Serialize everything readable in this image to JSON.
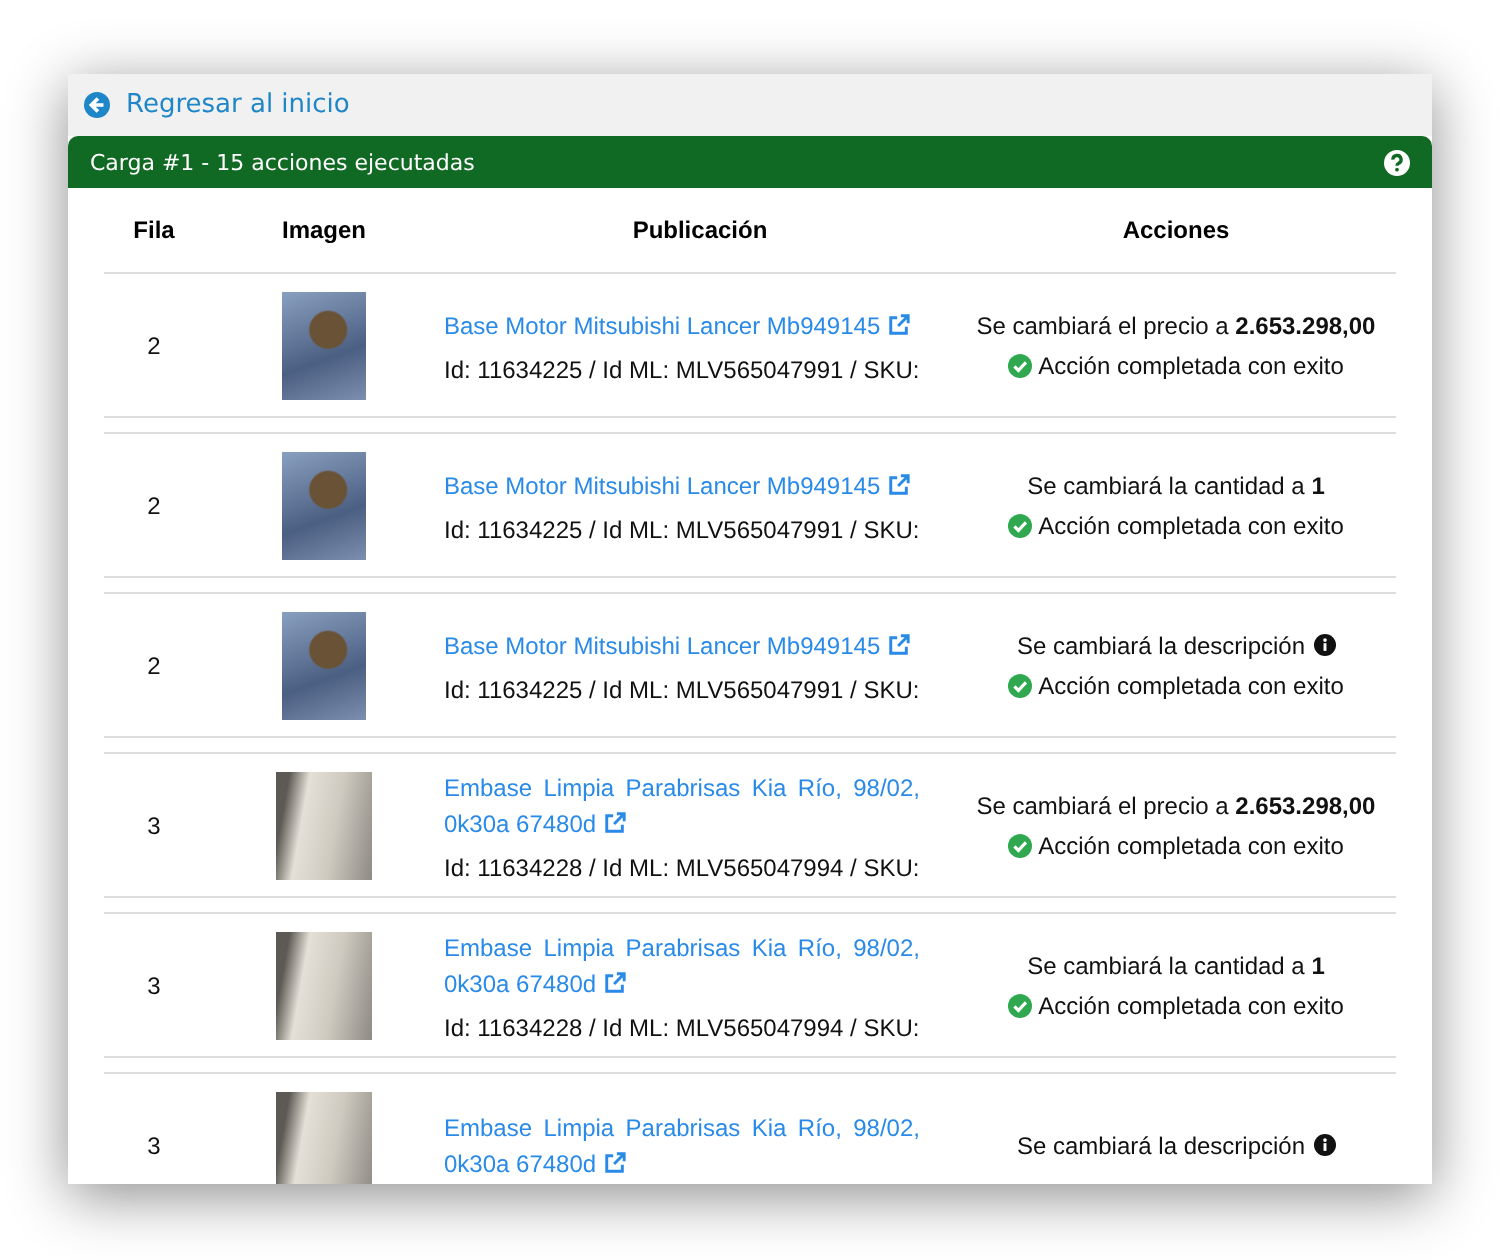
{
  "back_link": {
    "label": "Regresar al inicio"
  },
  "panel": {
    "title": "Carga #1 - 15 acciones ejecutadas"
  },
  "table": {
    "columns": [
      "Fila",
      "Imagen",
      "Publicación",
      "Acciones"
    ],
    "rows": [
      {
        "fila": "2",
        "title": "Base Motor Mitsubishi Lancer Mb949145",
        "meta": "Id: 11634225 / Id ML: MLV565047991 / SKU:",
        "action": {
          "kind": "price",
          "text": "Se cambiará el precio a **2.653.298,00**"
        },
        "status": {
          "success": true,
          "text": "Acción completada con exito"
        }
      },
      {
        "fila": "2",
        "title": "Base Motor Mitsubishi Lancer Mb949145",
        "meta": "Id: 11634225 / Id ML: MLV565047991 / SKU:",
        "action": {
          "kind": "quantity",
          "text": "Se cambiará la cantidad a **1**"
        },
        "status": {
          "success": true,
          "text": "Acción completada con exito"
        }
      },
      {
        "fila": "2",
        "title": "Base Motor Mitsubishi Lancer Mb949145",
        "meta": "Id: 11634225 / Id ML: MLV565047991 / SKU:",
        "action": {
          "kind": "description",
          "text": "Se cambiará la descripción"
        },
        "status": {
          "success": true,
          "text": "Acción completada con exito"
        }
      },
      {
        "fila": "3",
        "title": "Embase Limpia Parabrisas Kia Río, 98/02, 0k30a 67480d",
        "meta": "Id: 11634228 / Id ML: MLV565047994 / SKU:",
        "action": {
          "kind": "price",
          "text": "Se cambiará el precio a **2.653.298,00**"
        },
        "status": {
          "success": true,
          "text": "Acción completada con exito"
        }
      },
      {
        "fila": "3",
        "title": "Embase Limpia Parabrisas Kia Río, 98/02, 0k30a 67480d",
        "meta": "Id: 11634228 / Id ML: MLV565047994 / SKU:",
        "action": {
          "kind": "quantity",
          "text": "Se cambiará la cantidad a **1**"
        },
        "status": {
          "success": true,
          "text": "Acción completada con exito"
        }
      },
      {
        "fila": "3",
        "title": "Embase Limpia Parabrisas Kia Río, 98/02, 0k30a 67480d",
        "action": {
          "kind": "description",
          "text": "Se cambiará la descripción"
        }
      }
    ]
  }
}
